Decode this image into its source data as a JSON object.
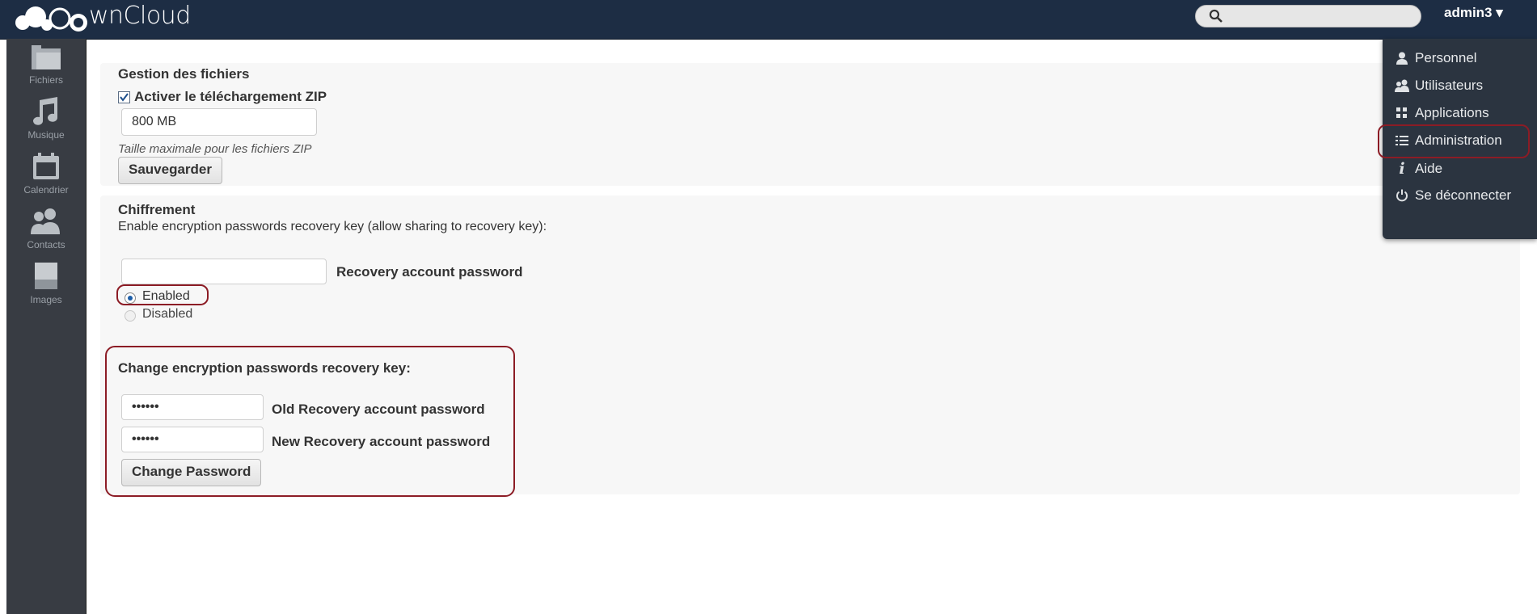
{
  "header": {
    "app_name": "ownCloud",
    "logo_text": "wnCloud",
    "search_placeholder": "",
    "user": "admin3 ▾"
  },
  "nav": [
    {
      "label": "Fichiers",
      "icon": "folder-icon"
    },
    {
      "label": "Musique",
      "icon": "music-note-icon"
    },
    {
      "label": "Calendrier",
      "icon": "calendar-icon"
    },
    {
      "label": "Contacts",
      "icon": "people-icon"
    },
    {
      "label": "Images",
      "icon": "image-icon"
    }
  ],
  "files_section": {
    "title": "Gestion des fichiers",
    "zip_checkbox_label": "Activer le téléchargement ZIP",
    "zip_checked": true,
    "zip_size_value": "800 MB",
    "zip_hint": "Taille maximale pour les fichiers ZIP",
    "save_label": "Sauvegarder"
  },
  "encryption_section": {
    "title": "Chiffrement",
    "description": "Enable encryption passwords recovery key (allow sharing to recovery key):",
    "recovery_password_value": "",
    "recovery_password_label": "Recovery account password",
    "enabled_label": "Enabled",
    "disabled_label": "Disabled",
    "change_title": "Change encryption passwords recovery key:",
    "old_password_value": "••••••",
    "old_password_label": "Old Recovery account password",
    "new_password_value": "••••••",
    "new_password_label": "New Recovery account password",
    "change_button": "Change Password"
  },
  "dropdown": [
    {
      "label": "Personnel",
      "icon": "person-icon"
    },
    {
      "label": "Utilisateurs",
      "icon": "users-icon"
    },
    {
      "label": "Applications",
      "icon": "apps-grid-icon"
    },
    {
      "label": "Administration",
      "icon": "list-icon"
    },
    {
      "label": "Aide",
      "icon": "info-icon"
    },
    {
      "label": "Se déconnecter",
      "icon": "power-icon"
    }
  ],
  "colors": {
    "header_bg": "#1d2d44",
    "nav_bg": "#383c43",
    "highlight": "#8c1c25"
  }
}
